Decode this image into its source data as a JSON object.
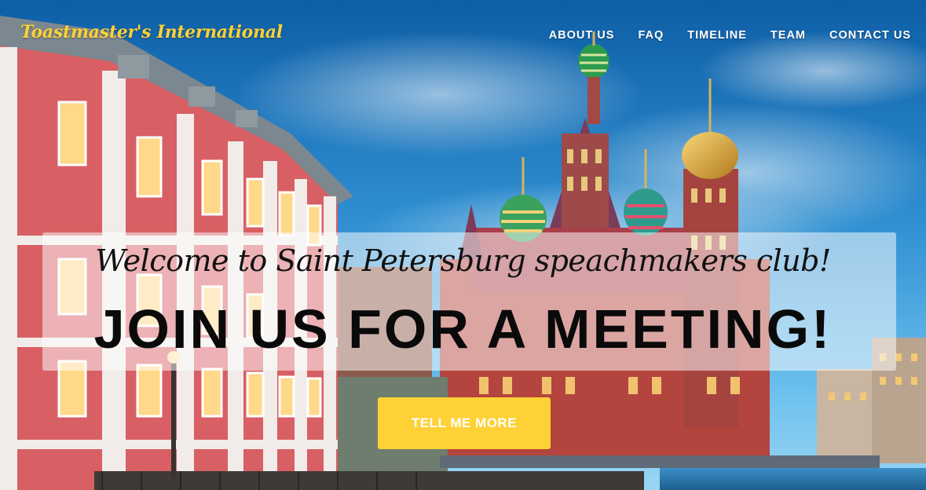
{
  "brand": {
    "name": "Toastmaster's International"
  },
  "nav": {
    "items": [
      {
        "label": "ABOUT US"
      },
      {
        "label": "FAQ"
      },
      {
        "label": "TIMELINE"
      },
      {
        "label": "TEAM"
      },
      {
        "label": "CONTACT US"
      }
    ]
  },
  "hero": {
    "subtitle": "Welcome to Saint Petersburg speachmakers club!",
    "headline": "JOIN US FOR A MEETING!",
    "cta_label": "TELL ME MORE"
  },
  "colors": {
    "accent": "#fed136",
    "sky": "#1f7fc4",
    "building_pink": "#d4555e"
  }
}
